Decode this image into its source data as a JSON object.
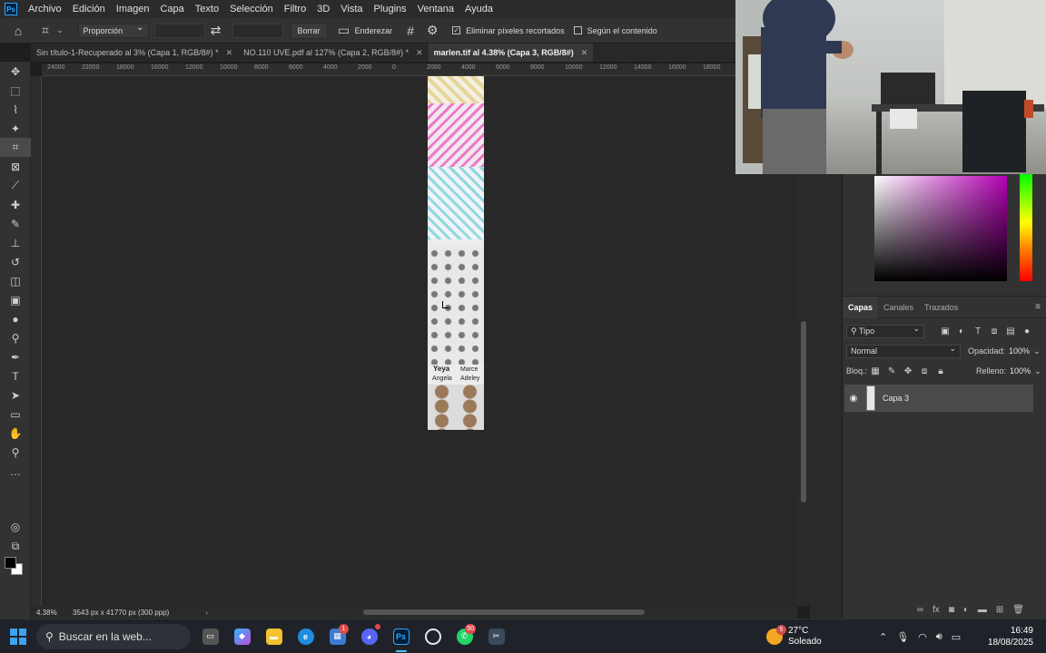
{
  "app": {
    "logo": "Ps"
  },
  "menu": [
    "Archivo",
    "Edición",
    "Imagen",
    "Capa",
    "Texto",
    "Selección",
    "Filtro",
    "3D",
    "Vista",
    "Plugins",
    "Ventana",
    "Ayuda"
  ],
  "options": {
    "ratio": "Proporción",
    "clear": "Borrar",
    "straighten": "Enderezar",
    "delete_cropped": "Eliminar píxeles recortados",
    "content_aware": "Según el contenido"
  },
  "tabs": [
    {
      "label": "Sin título-1-Recuperado al 3% (Capa 1, RGB/8#) *",
      "active": false
    },
    {
      "label": "NO.110 UVE.pdf al 127% (Capa 2, RGB/8#) *",
      "active": false
    },
    {
      "label": "marlen.tif al 4.38% (Capa 3, RGB/8#)",
      "active": true
    }
  ],
  "ruler_ticks": [
    "24000",
    "22000",
    "18000",
    "16000",
    "12000",
    "10000",
    "8000",
    "6000",
    "4000",
    "2000",
    "0",
    "2000",
    "4000",
    "6000",
    "8000",
    "10000",
    "12000",
    "14000",
    "16000",
    "18000"
  ],
  "document": {
    "name_left": "Yeya",
    "sub_left": "Angela",
    "name_right": "Marce",
    "sub_right": "Adeley"
  },
  "status": {
    "zoom": "4.38%",
    "info": "3543 px x 41770 px (300 ppp)"
  },
  "layers_panel": {
    "tabs": [
      "Capas",
      "Canales",
      "Trazados"
    ],
    "filter": "Tipo",
    "blend_mode": "Normal",
    "opacity_label": "Opacidad:",
    "opacity": "100%",
    "lock_label": "Bloq.:",
    "fill_label": "Relleno:",
    "fill": "100%",
    "layers": [
      {
        "name": "Capa 3",
        "visible": true
      }
    ]
  },
  "taskbar": {
    "search": "Buscar en la web...",
    "badges": {
      "app5": "1",
      "app8": "50"
    },
    "weather_temp": "27°C",
    "weather_desc": "Soleado",
    "weather_badge": "5",
    "time": "16:49",
    "date": "18/08/2025"
  }
}
